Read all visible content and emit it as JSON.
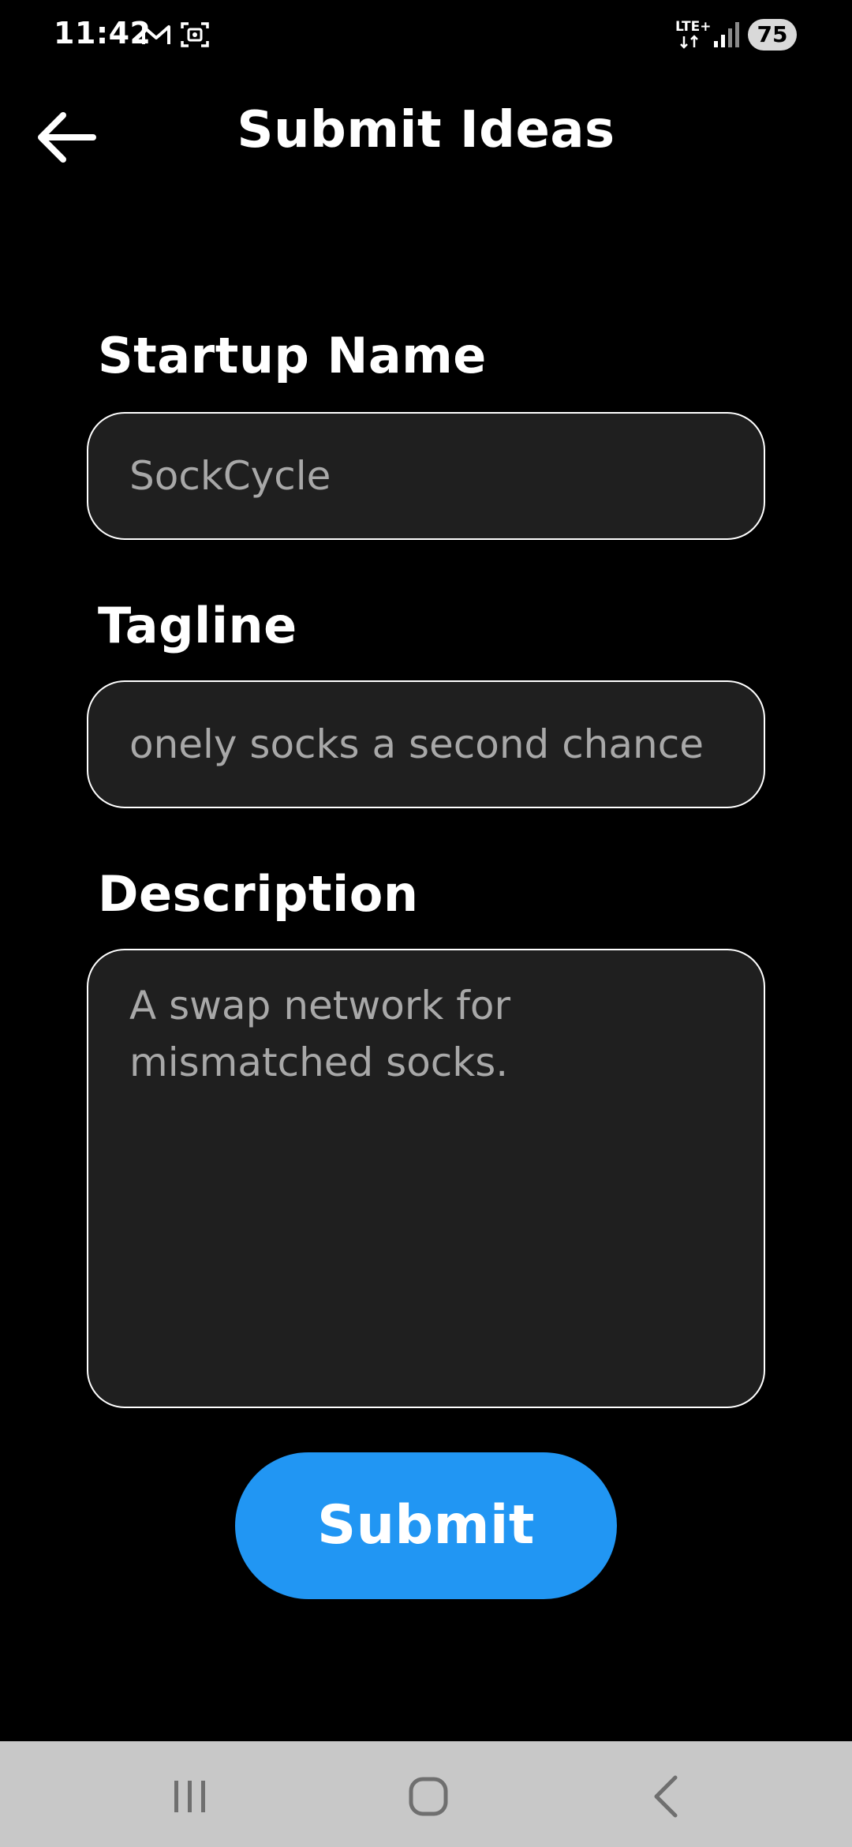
{
  "status_bar": {
    "time": "11:42",
    "network": "LTE+",
    "battery": "75",
    "icons": [
      "gmail-icon",
      "screenshot-icon",
      "lte-icon",
      "signal-icon",
      "battery-icon"
    ]
  },
  "app_bar": {
    "title": "Submit Ideas",
    "back_icon": "arrow-left-icon"
  },
  "form": {
    "startup_name": {
      "label": "Startup Name",
      "value": "SockCycle"
    },
    "tagline": {
      "label": "Tagline",
      "value": "onely socks a second chance"
    },
    "description": {
      "label": "Description",
      "value": "A swap network for mismatched socks."
    },
    "submit_label": "Submit"
  },
  "nav_bar": {
    "icons": [
      "recents-icon",
      "home-icon",
      "back-icon"
    ]
  },
  "colors": {
    "background": "#000000",
    "field_background": "#1f1f1f",
    "field_text": "#a8a8a8",
    "accent": "#2196f3",
    "nav_bar": "#c8c8c8"
  }
}
